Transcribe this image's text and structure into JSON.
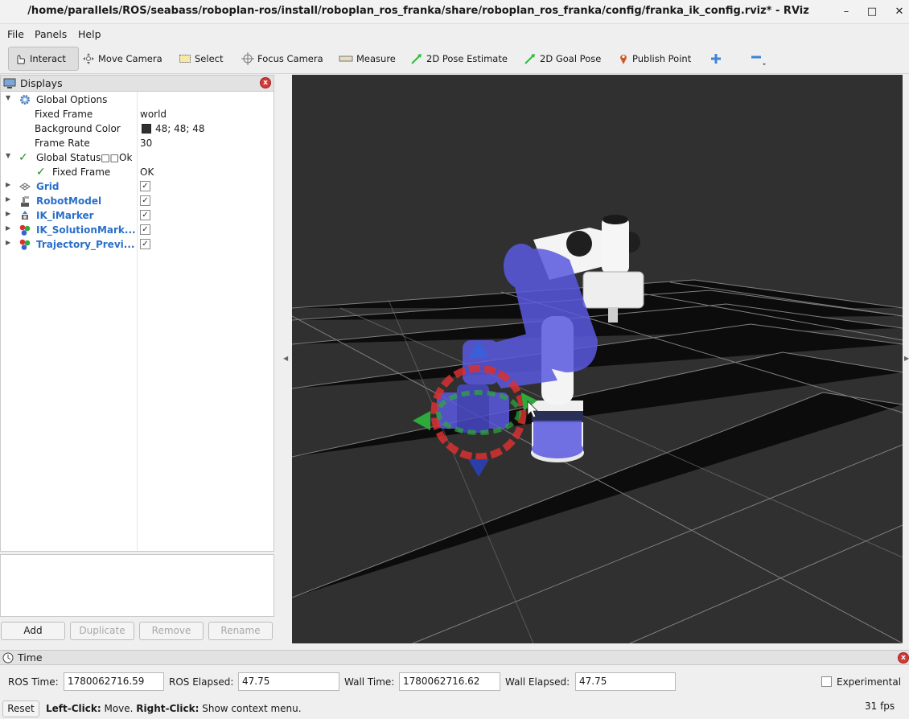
{
  "window": {
    "title": "/home/parallels/ROS/seabass/roboplan-ros/install/roboplan_ros_franka/share/roboplan_ros_franka/config/franka_ik_config.rviz* - RViz",
    "minimize": "–",
    "maximize": "□",
    "close": "✕"
  },
  "menu": {
    "file": "File",
    "panels": "Panels",
    "help": "Help"
  },
  "toolbar": {
    "interact": "Interact",
    "move_camera": "Move Camera",
    "select": "Select",
    "focus_camera": "Focus Camera",
    "measure": "Measure",
    "pose_estimate": "2D Pose Estimate",
    "goal_pose": "2D Goal Pose",
    "publish_point": "Publish Point"
  },
  "displays": {
    "title": "Displays",
    "close": "x",
    "global_options": {
      "label": "Global Options",
      "fixed_frame_label": "Fixed Frame",
      "fixed_frame_value": "world",
      "background_color_label": "Background Color",
      "background_color_value": "48; 48; 48",
      "background_color_hex": "#303030",
      "frame_rate_label": "Frame Rate",
      "frame_rate_value": "30"
    },
    "global_status": {
      "label": "Global Status□□Ok",
      "fixed_frame_label": "Fixed Frame",
      "fixed_frame_value": "OK"
    },
    "items": [
      {
        "label": "Grid",
        "checked": "✓",
        "icon": "grid-icon"
      },
      {
        "label": "RobotModel",
        "checked": "✓",
        "icon": "robot-model-icon"
      },
      {
        "label": "IK_iMarker",
        "checked": "✓",
        "icon": "interactive-marker-icon"
      },
      {
        "label": "IK_SolutionMark...",
        "checked": "✓",
        "icon": "marker-array-icon"
      },
      {
        "label": "Trajectory_Previ...",
        "checked": "✓",
        "icon": "marker-array-icon"
      }
    ],
    "buttons": {
      "add": "Add",
      "duplicate": "Duplicate",
      "remove": "Remove",
      "rename": "Rename"
    }
  },
  "time": {
    "title": "Time",
    "close": "x",
    "ros_time_label": "ROS Time:",
    "ros_time_value": "1780062716.59",
    "ros_elapsed_label": "ROS Elapsed:",
    "ros_elapsed_value": "47.75",
    "wall_time_label": "Wall Time:",
    "wall_time_value": "1780062716.62",
    "wall_elapsed_label": "Wall Elapsed:",
    "wall_elapsed_value": "47.75",
    "experimental_label": "Experimental"
  },
  "status": {
    "reset": "Reset",
    "left_click": "Left-Click:",
    "left_click_action": " Move. ",
    "right_click": "Right-Click:",
    "right_click_action": " Show context menu.",
    "fps": "31 fps"
  }
}
